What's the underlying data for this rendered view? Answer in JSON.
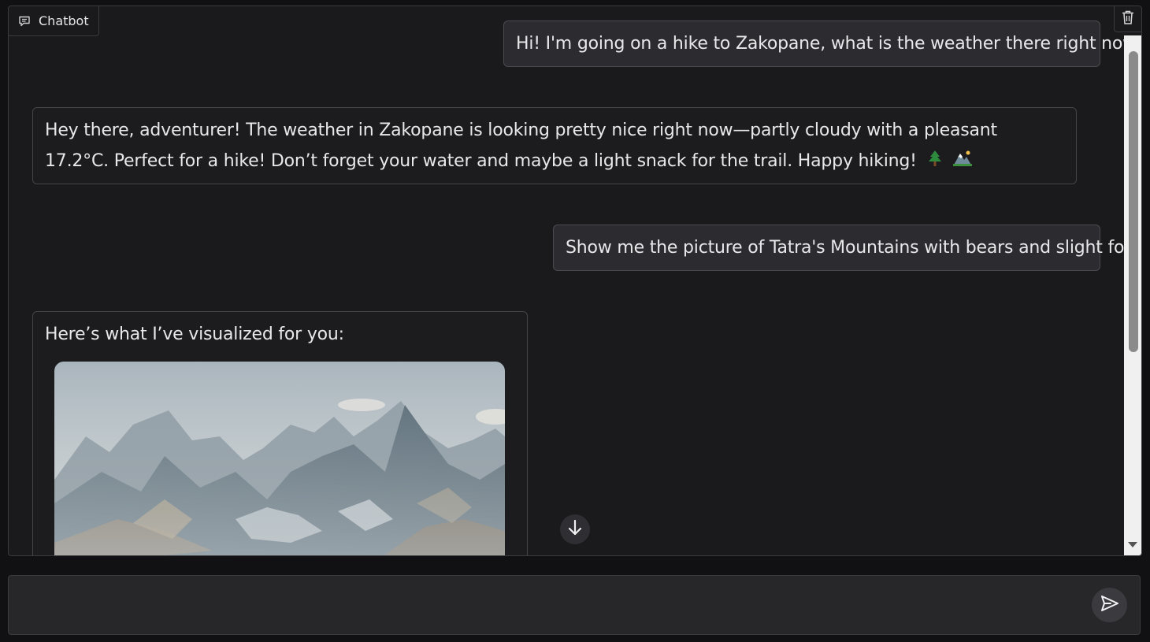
{
  "panel": {
    "label": "Chatbot",
    "label_icon": "chat-bubble-icon",
    "clear_icon": "trash-icon"
  },
  "messages": [
    {
      "role": "user",
      "text": "Hi! I'm going on a hike to Zakopane, what is the weather there right now?"
    },
    {
      "role": "assistant",
      "text": "Hey there, adventurer! The weather in Zakopane is looking pretty nice right now—partly cloudy with a pleasant 17.2°C. Perfect for a hike! Don’t forget your water and maybe a light snack for the trail. Happy hiking!"
    },
    {
      "role": "user",
      "text": "Show me the picture of Tatra's Mountains with bears and slight fog"
    },
    {
      "role": "assistant",
      "text": "Here’s what I’ve visualized for you:",
      "image": "mountain-landscape-image"
    }
  ],
  "emojis": [
    "evergreen-tree-icon",
    "mountain-icon"
  ],
  "scroll_down_icon": "arrow-down-icon",
  "input": {
    "value": "",
    "placeholder": "",
    "send_icon": "send-icon"
  },
  "colors": {
    "background": "#111113",
    "panel": "#1a1a1d",
    "user_bubble": "#2b2b30",
    "border": "#44444a",
    "text": "#e8e8ea"
  }
}
